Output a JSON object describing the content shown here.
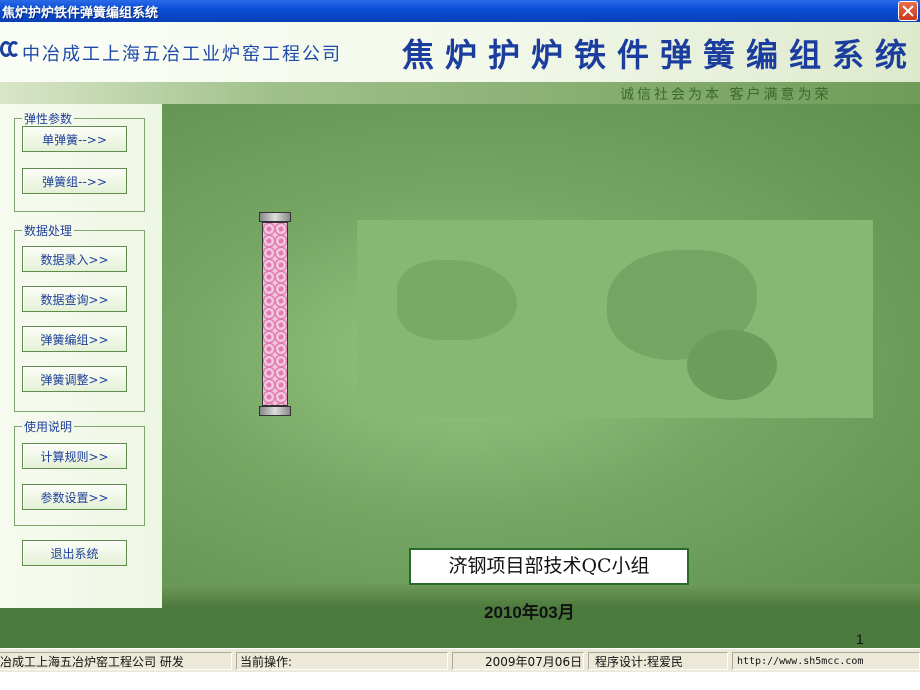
{
  "window": {
    "title": "焦炉护炉铁件弹簧编组系统"
  },
  "header": {
    "company": "中冶成工上海五冶工业炉窑工程公司",
    "system_title": "焦炉护炉铁件弹簧编组系统",
    "slogan": "诚信社会为本  客户满意为荣"
  },
  "sidebar": {
    "groups": [
      {
        "label": "弹性参数",
        "buttons": [
          "单弹簧-->>",
          "弹簧组-->>"
        ]
      },
      {
        "label": "数据处理",
        "buttons": [
          "数据录入>>",
          "数据查询>>",
          "弹簧编组>>",
          "弹簧调整>>"
        ]
      },
      {
        "label": "使用说明",
        "buttons": [
          "计算规则>>",
          "参数设置>>"
        ]
      }
    ],
    "exit_button": "退出系统"
  },
  "main": {
    "team_label": "济钢项目部技术QC小组",
    "date_label": "2010年03月"
  },
  "statusbar": {
    "company": "冶成工上海五冶炉窑工程公司 研发",
    "current_op": "当前操作:",
    "date": "2009年07月06日",
    "designer": "程序设计:程爱民",
    "url": "http://www.sh5mcc.com"
  },
  "page_number": "1",
  "colors": {
    "title_blue": "#1a3d9e",
    "panel_green": "#76a663"
  },
  "icons": {
    "close": "close-icon",
    "logo": "cc-logo-icon"
  }
}
